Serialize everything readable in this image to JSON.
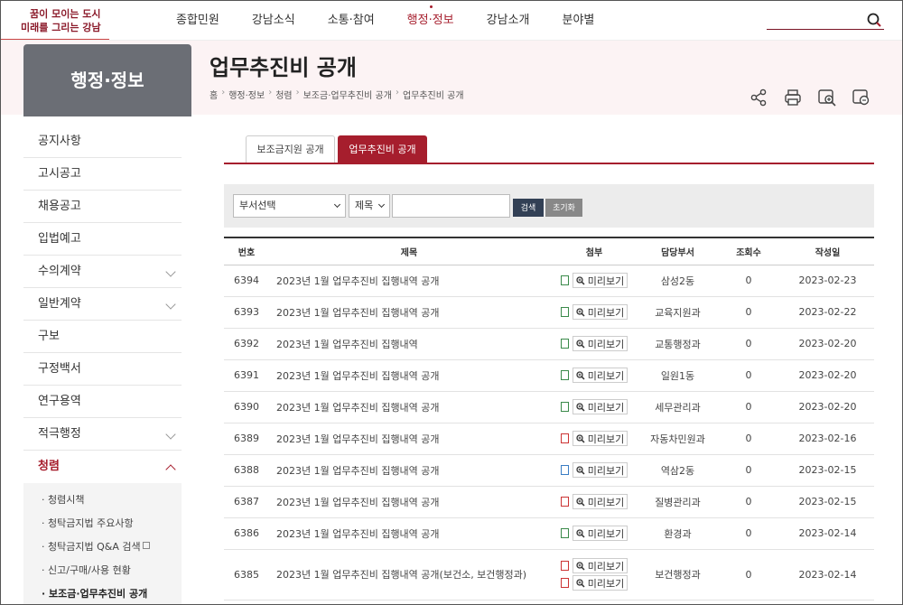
{
  "logo": {
    "line1": "꿈이 모이는 도시",
    "line2": "미래를 그리는 강남"
  },
  "gnb": [
    {
      "label": "종합민원",
      "active": false
    },
    {
      "label": "강남소식",
      "active": false
    },
    {
      "label": "소통·참여",
      "active": false
    },
    {
      "label": "행정·정보",
      "active": true
    },
    {
      "label": "강남소개",
      "active": false
    },
    {
      "label": "분야별",
      "active": false
    }
  ],
  "search": {
    "value": ""
  },
  "lnb": {
    "title": "행정·정보",
    "items": [
      {
        "label": "공지사항",
        "chevron": false
      },
      {
        "label": "고시공고",
        "chevron": false
      },
      {
        "label": "채용공고",
        "chevron": false
      },
      {
        "label": "입법예고",
        "chevron": false
      },
      {
        "label": "수의계약",
        "chevron": true
      },
      {
        "label": "일반계약",
        "chevron": true
      },
      {
        "label": "구보",
        "chevron": false
      },
      {
        "label": "구정백서",
        "chevron": false
      },
      {
        "label": "연구용역",
        "chevron": false
      },
      {
        "label": "적극행정",
        "chevron": true
      },
      {
        "label": "청렴",
        "chevron": true,
        "active": true
      }
    ],
    "sub": [
      {
        "label": "· 청렴시책"
      },
      {
        "label": "· 청탁금지법 주요사항"
      },
      {
        "label": "· 청탁금지법 Q&A 검색",
        "external": true
      },
      {
        "label": "· 신고/구매/사용 현황"
      },
      {
        "label": "· 보조금·업무추진비 공개",
        "active": true
      }
    ]
  },
  "page": {
    "title": "업무추진비 공개",
    "breadcrumb": [
      "홈",
      "행정·정보",
      "청렴",
      "보조금·업무추진비 공개",
      "업무추진비 공개"
    ]
  },
  "tools": [
    "share-icon",
    "print-icon",
    "zoom-in-icon",
    "zoom-out-icon"
  ],
  "tabs": [
    {
      "label": "보조금지원 공개",
      "active": false
    },
    {
      "label": "업무추진비 공개",
      "active": true
    }
  ],
  "filter": {
    "dept_selected": "부서선택",
    "field_selected": "제목",
    "keyword": "",
    "search_label": "검색",
    "reset_label": "초기화"
  },
  "table": {
    "headers": [
      "번호",
      "제목",
      "첨부",
      "담당부서",
      "조회수",
      "작성일"
    ],
    "preview_label": "미리보기",
    "rows": [
      {
        "no": "6394",
        "title": "2023년 1월 업무추진비 집행내역 공개",
        "files": [
          "xls"
        ],
        "dept": "삼성2동",
        "views": "0",
        "date": "2023-02-23"
      },
      {
        "no": "6393",
        "title": "2023년 1월 업무추진비 집행내역 공개",
        "files": [
          "xls"
        ],
        "dept": "교육지원과",
        "views": "0",
        "date": "2023-02-22"
      },
      {
        "no": "6392",
        "title": "2023년 1월 업무추진비 집행내역",
        "files": [
          "xls"
        ],
        "dept": "교통행정과",
        "views": "0",
        "date": "2023-02-20"
      },
      {
        "no": "6391",
        "title": "2023년 1월 업무추진비 집행내역 공개",
        "files": [
          "xls"
        ],
        "dept": "일원1동",
        "views": "0",
        "date": "2023-02-20"
      },
      {
        "no": "6390",
        "title": "2023년 1월 업무추진비 집행내역 공개",
        "files": [
          "xls"
        ],
        "dept": "세무관리과",
        "views": "0",
        "date": "2023-02-20"
      },
      {
        "no": "6389",
        "title": "2023년 1월 업무추진비 집행내역 공개",
        "files": [
          "pdf"
        ],
        "dept": "자동차민원과",
        "views": "0",
        "date": "2023-02-16"
      },
      {
        "no": "6388",
        "title": "2023년 1월 업무추진비 집행내역 공개",
        "files": [
          "hwp"
        ],
        "dept": "역삼2동",
        "views": "0",
        "date": "2023-02-15"
      },
      {
        "no": "6387",
        "title": "2023년 1월 업무추진비 집행내역 공개",
        "files": [
          "pdf"
        ],
        "dept": "질병관리과",
        "views": "0",
        "date": "2023-02-15"
      },
      {
        "no": "6386",
        "title": "2023년 1월 업무추진비 집행내역 공개",
        "files": [
          "xls"
        ],
        "dept": "환경과",
        "views": "0",
        "date": "2023-02-14"
      },
      {
        "no": "6385",
        "title": "2023년 1월 업무추진비 집행내역 공개(보건소, 보건행정과)",
        "files": [
          "pdf",
          "pdf"
        ],
        "dept": "보건행정과",
        "views": "0",
        "date": "2023-02-14"
      }
    ]
  },
  "colors": {
    "accent": "#a61e2d",
    "lnb_title_bg": "#6b6e75",
    "band": "#fcf3f4",
    "search_btn": "#324055"
  }
}
